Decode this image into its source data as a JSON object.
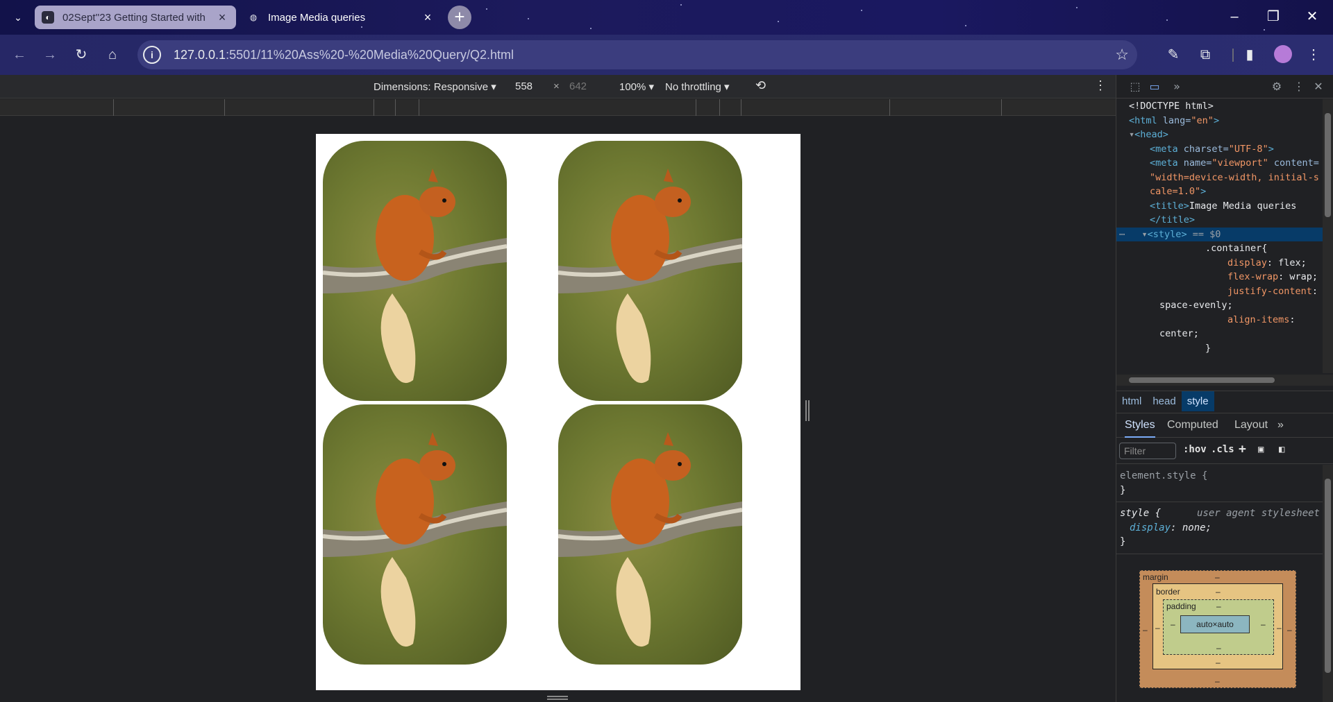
{
  "tabs": [
    {
      "title": "02Sept''23 Getting Started with",
      "active": true
    },
    {
      "title": "Image Media queries",
      "active": false
    }
  ],
  "address": {
    "host": "127.0.0.1",
    "rest": ":5501/11%20Ass%20-%20Media%20Query/Q2.html"
  },
  "device_toolbar": {
    "dimensions": "Dimensions: Responsive",
    "width": "558",
    "times": "×",
    "height": "642",
    "zoom": "100%",
    "throttling": "No throttling"
  },
  "viewport": {
    "cards": [
      {
        "name": "squirrel-card-1"
      },
      {
        "name": "squirrel-card-2"
      },
      {
        "name": "squirrel-card-3"
      },
      {
        "name": "squirrel-card-4"
      }
    ]
  },
  "devtools": {
    "dom_lines": {
      "doctype": "<!DOCTYPE html>",
      "html_tag": "<html",
      "html_attr": " lang=",
      "html_val": "\"en\"",
      "html_close": ">",
      "head": "<head>",
      "meta1_tag": "<meta",
      "meta1_attr": " charset=",
      "meta1_val": "\"UTF-8\"",
      "meta1_close": ">",
      "meta2_tag": "<meta",
      "meta2_attr": " name=",
      "meta2_val": "\"viewport\"",
      "meta2_attr2": " content=",
      "meta2_val2a": "\"width=device-width, initial-s",
      "meta2_val2b": "cale=1.0\"",
      "meta2_close": ">",
      "title_open": "<title>",
      "title_text": "Image Media queries",
      "title_close": "</title>",
      "style_open": "<style>",
      "style_eq": " == $0",
      "css1": ".container{",
      "css2_prop": "display",
      "css2_val": ": flex;",
      "css3_prop": "flex-wrap",
      "css3_val": ": wrap;",
      "css4_prop": "justify-content",
      "css4_val": ":",
      "css5": "space-evenly;",
      "css6_prop": "align-items",
      "css6_val": ":",
      "css7": "center;",
      "css8": "}"
    },
    "breadcrumbs": [
      "html",
      "head",
      "style"
    ],
    "subtabs": [
      "Styles",
      "Computed",
      "Layout",
      "»"
    ],
    "filter_placeholder": "Filter",
    "hov": ":hov",
    "cls": ".cls",
    "rules": {
      "element_style": "element.style {",
      "close1": "}",
      "style_sel": "style {",
      "uas": "user agent stylesheet",
      "display_prop": "display",
      "display_val": ": none;",
      "close2": "}"
    },
    "box_model": {
      "margin": "margin",
      "border": "border",
      "padding": "padding",
      "content": "auto×auto",
      "dash": "–"
    }
  },
  "colors": {
    "titlebar": "#1a1860",
    "accent": "#7cacf8",
    "selected": "#073b68"
  }
}
